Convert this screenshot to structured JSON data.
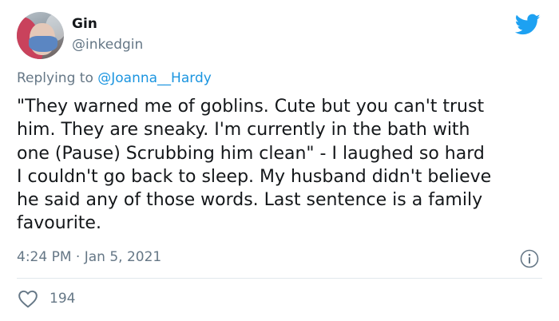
{
  "author": {
    "name": "Gin",
    "handle": "@inkedgin"
  },
  "reply": {
    "prefix": "Replying to ",
    "target": "@Joanna__Hardy"
  },
  "tweet": {
    "text": "\"They warned me of goblins. Cute but you can't trust\nhim. They are sneaky. I'm currently in the bath with\none (Pause) Scrubbing him clean\" - I laughed so hard\nI couldn't go back to sleep. My husband didn't believe\nhe said any of those words. Last sentence is a family\nfavourite.",
    "time": "4:24 PM",
    "separator": " · ",
    "date": "Jan 5, 2021"
  },
  "stats": {
    "likes": "194"
  },
  "icons": {
    "brand": "twitter-bird-icon",
    "info": "info-icon",
    "like": "heart-icon"
  },
  "colors": {
    "brand": "#1da1f2",
    "link": "#1b95e0",
    "secondary_text": "#657786",
    "primary_text": "#14171a",
    "divider": "#e1e8ed"
  }
}
